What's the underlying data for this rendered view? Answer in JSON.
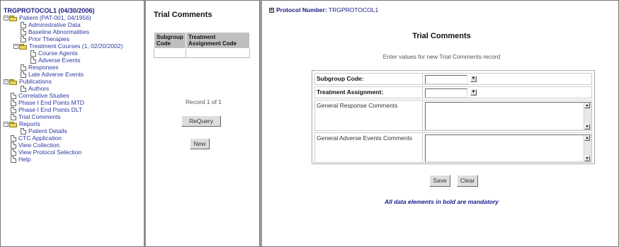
{
  "left_nav": {
    "title": "TRGPROTOCOL1 (04/30/2006)",
    "items": [
      {
        "label": "Patient (PAT-001, 04/1956)",
        "kind": "folder",
        "expander": "−",
        "indent": 0
      },
      {
        "label": "Administrative Data",
        "kind": "doc",
        "indent": 1
      },
      {
        "label": "Baseline Abnormalities",
        "kind": "doc",
        "indent": 1
      },
      {
        "label": "Prior Therapies",
        "kind": "doc",
        "indent": 1
      },
      {
        "label": "Treatment Courses (1, 02/20/2002)",
        "kind": "folder",
        "expander": "−",
        "indent": 1
      },
      {
        "label": "Course Agents",
        "kind": "doc",
        "indent": 2
      },
      {
        "label": "Adverse Events",
        "kind": "doc",
        "indent": 2
      },
      {
        "label": "Responses",
        "kind": "doc",
        "indent": 1
      },
      {
        "label": "Late Adverse Events",
        "kind": "doc",
        "indent": 1
      },
      {
        "label": "Publications",
        "kind": "folder",
        "expander": "−",
        "indent": 0
      },
      {
        "label": "Authors",
        "kind": "doc",
        "indent": 1
      },
      {
        "label": "Correlative Studies",
        "kind": "doc",
        "indent": 0
      },
      {
        "label": "Phase I End Points MTD",
        "kind": "doc",
        "indent": 0
      },
      {
        "label": "Phase I End Points DLT",
        "kind": "doc",
        "indent": 0
      },
      {
        "label": "Trial Comments",
        "kind": "doc",
        "indent": 0
      },
      {
        "label": "Reports",
        "kind": "folder",
        "expander": "−",
        "indent": 0
      },
      {
        "label": "Patient Details",
        "kind": "doc",
        "indent": 1
      },
      {
        "label": "CTC Application",
        "kind": "doc",
        "indent": 0
      },
      {
        "label": "View Collection",
        "kind": "doc",
        "indent": 0
      },
      {
        "label": "View Protocol Selection",
        "kind": "doc",
        "indent": 0
      },
      {
        "label": "Help",
        "kind": "doc",
        "indent": 0
      }
    ]
  },
  "middle": {
    "title": "Trial Comments",
    "columns": [
      "Subgroup Code",
      "Treatment Assignment Code"
    ],
    "record_text": "Record 1 of 1",
    "requery_label": "ReQuery",
    "new_label": "New"
  },
  "main": {
    "protocol_label": "Protocol Number:",
    "protocol_value": "TRGPROTOCOL1",
    "form_title": "Trial Comments",
    "instruction": "Enter values for new Trial Comments record",
    "fields": [
      {
        "label": "Subgroup Code:",
        "bold": true,
        "type": "select",
        "value": ""
      },
      {
        "label": "Treatment Assignment:",
        "bold": true,
        "type": "select",
        "value": ""
      },
      {
        "label": "General Response Comments",
        "bold": false,
        "type": "textarea",
        "value": ""
      },
      {
        "label": "General Adverse Events Comments",
        "bold": false,
        "type": "textarea",
        "value": ""
      }
    ],
    "save_label": "Save",
    "clear_label": "Clear",
    "mandatory_note": "All data elements in bold are mandatory"
  },
  "colors": {
    "link": "#2b3aa0",
    "title": "#1a1a80",
    "button_bg": "#dddddd",
    "grid_header": "#bfbfbf"
  },
  "icons": [
    "folder-icon",
    "document-icon",
    "expand-collapse-icon",
    "dropdown-arrow-icon",
    "scroll-arrow-icon"
  ]
}
